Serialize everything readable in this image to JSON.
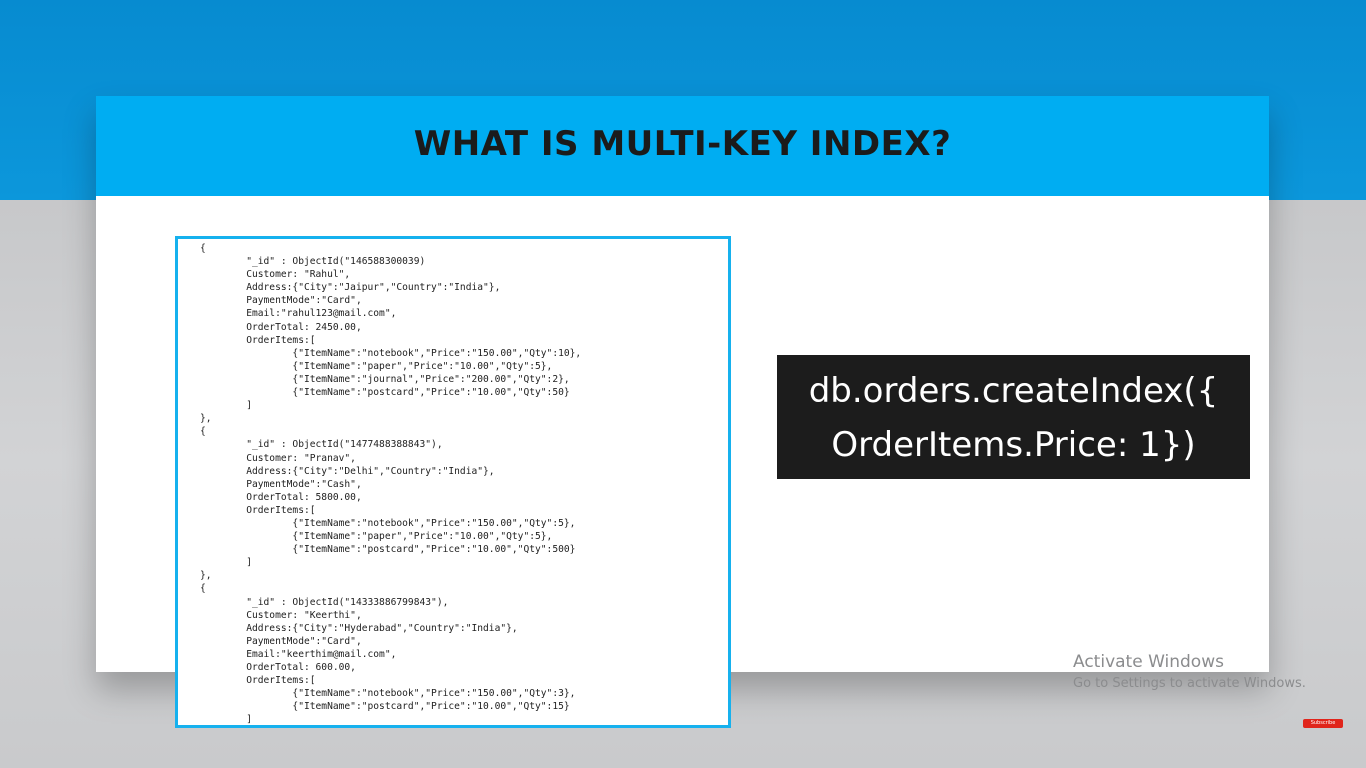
{
  "slide": {
    "title": "WHAT IS MULTI-KEY INDEX?"
  },
  "code_sample": {
    "lines": [
      "{",
      "        \"_id\" : ObjectId(\"146588300039)",
      "        Customer: \"Rahul\",",
      "        Address:{\"City\":\"Jaipur\",\"Country\":\"India\"},",
      "        PaymentMode\":\"Card\",",
      "        Email:\"rahul123@mail.com\",",
      "        OrderTotal: 2450.00,",
      "        OrderItems:[",
      "                {\"ItemName\":\"notebook\",\"Price\":\"150.00\",\"Qty\":10},",
      "                {\"ItemName\":\"paper\",\"Price\":\"10.00\",\"Qty\":5},",
      "                {\"ItemName\":\"journal\",\"Price\":\"200.00\",\"Qty\":2},",
      "                {\"ItemName\":\"postcard\",\"Price\":\"10.00\",\"Qty\":50}",
      "        ]",
      "},",
      "{",
      "        \"_id\" : ObjectId(\"1477488388843\"),",
      "        Customer: \"Pranav\",",
      "        Address:{\"City\":\"Delhi\",\"Country\":\"India\"},",
      "        PaymentMode\":\"Cash\",",
      "        OrderTotal: 5800.00,",
      "        OrderItems:[",
      "                {\"ItemName\":\"notebook\",\"Price\":\"150.00\",\"Qty\":5},",
      "                {\"ItemName\":\"paper\",\"Price\":\"10.00\",\"Qty\":5},",
      "                {\"ItemName\":\"postcard\",\"Price\":\"10.00\",\"Qty\":500}",
      "        ]",
      "},",
      "{",
      "        \"_id\" : ObjectId(\"14333886799843\"),",
      "        Customer: \"Keerthi\",",
      "        Address:{\"City\":\"Hyderabad\",\"Country\":\"India\"},",
      "        PaymentMode\":\"Card\",",
      "        Email:\"keerthim@mail.com\",",
      "        OrderTotal: 600.00,",
      "        OrderItems:[",
      "                {\"ItemName\":\"notebook\",\"Price\":\"150.00\",\"Qty\":3},",
      "                {\"ItemName\":\"postcard\",\"Price\":\"10.00\",\"Qty\":15}",
      "        ]"
    ]
  },
  "command": {
    "line1": "db.orders.createIndex({",
    "line2": "OrderItems.Price: 1})"
  },
  "watermark": {
    "title": "Activate Windows",
    "subtitle": "Go to Settings to activate Windows."
  },
  "youtube": {
    "subscribe_label": "Subscribe"
  },
  "colors": {
    "header_blue": "#00adf2",
    "background_blue": "#0a8fd0",
    "code_border": "#16b1ee",
    "command_bg": "#1c1c1c"
  }
}
